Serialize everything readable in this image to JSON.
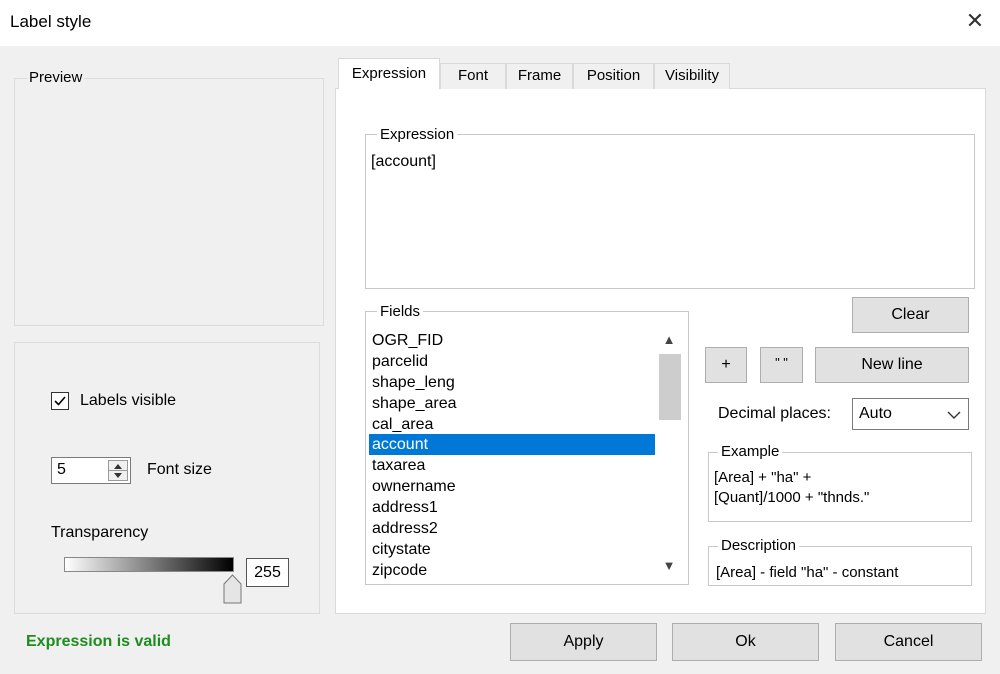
{
  "window": {
    "title": "Label style",
    "close_icon": "close-icon"
  },
  "preview": {
    "legend": "Preview"
  },
  "left_panel": {
    "labels_visible": "Labels visible",
    "labels_visible_checked": true,
    "font_size_value": "5",
    "font_size_label": "Font size",
    "transparency_label": "Transparency",
    "transparency_value": "255"
  },
  "tabs": [
    "Expression",
    "Font",
    "Frame",
    "Position",
    "Visibility"
  ],
  "expression": {
    "legend": "Expression",
    "value": "[account]"
  },
  "fields": {
    "legend": "Fields",
    "items": [
      "OGR_FID",
      "parcelid",
      "shape_leng",
      "shape_area",
      "cal_area",
      "account",
      "taxarea",
      "ownername",
      "address1",
      "address2",
      "citystate",
      "zipcode"
    ],
    "selected": "account"
  },
  "buttons": {
    "clear": "Clear",
    "plus": "+",
    "quotes": "\" \"",
    "new_line": "New line",
    "apply": "Apply",
    "ok": "Ok",
    "cancel": "Cancel"
  },
  "decimal": {
    "label": "Decimal places:",
    "value": "Auto"
  },
  "example": {
    "legend": "Example",
    "line1": "[Area] + \"ha\" +",
    "line2": "[Quant]/1000 + \"thnds.\""
  },
  "description": {
    "legend": "Description",
    "text": "[Area]  - field \"ha\" - constant"
  },
  "status": {
    "text": "Expression is valid",
    "color": "#1e8c1e"
  },
  "colors": {
    "selection": "#0078d7"
  }
}
